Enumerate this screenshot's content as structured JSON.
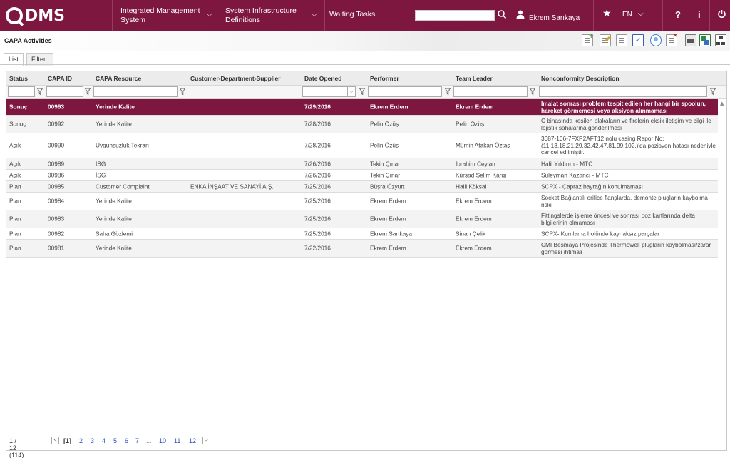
{
  "app": {
    "logo_text": "DMS",
    "menu": [
      {
        "label": "Integrated Management System"
      },
      {
        "label": "System Infrastructure Definitions"
      },
      {
        "label": "Waiting Tasks"
      }
    ],
    "search": {
      "value": "",
      "placeholder": ""
    },
    "user_name": "Ekrem Sarıkaya",
    "language": "EN"
  },
  "page": {
    "title": "CAPA Activities",
    "tabs": [
      {
        "label": "List"
      },
      {
        "label": "Filter"
      }
    ],
    "active_tab": "List"
  },
  "grid": {
    "columns": [
      "Status",
      "CAPA ID",
      "CAPA Resource",
      "Customer-Department-Supplier",
      "Date Opened",
      "Performer",
      "Team Leader",
      "Nonconformity Description"
    ],
    "rows": [
      {
        "status": "Sonuç",
        "id": "00993",
        "resource": "Yerinde Kalite",
        "customer": "",
        "date": "7/29/2016",
        "performer": "Ekrem Erdem",
        "leader": "Ekrem Erdem",
        "desc1": "İmalat sonrası problem tespit edilen her hangi bir spoolun,",
        "desc2": "hareket görmemesi veya aksiyon alınmaması",
        "selected": true
      },
      {
        "status": "Sonuç",
        "id": "00992",
        "resource": "Yerinde Kalite",
        "customer": "",
        "date": "7/28/2016",
        "performer": "Pelin Özüş",
        "leader": "Pelin Özüş",
        "desc1": "C binasında kesilen plakaların ve firelerin eksik iletişim ve bilgi ile",
        "desc2": "lojistik sahalarına gönderilmesi"
      },
      {
        "status": "Açık",
        "id": "00990",
        "resource": "Uygunsuzluk Tekrarı",
        "customer": "",
        "date": "7/28/2016",
        "performer": "Pelin Özüş",
        "leader": "Mümin Atakan Öztaş",
        "desc1": "3087-106-7FXP2AFT12 nolu casing Rapor No:",
        "desc2": "(11,13,18,21,29,32,42,47,81,99,102,)'da pozisyon hatası nedeniyle",
        "desc3": "cancel edilmiştir."
      },
      {
        "status": "Açık",
        "id": "00989",
        "resource": "İSG",
        "customer": "",
        "date": "7/26/2016",
        "performer": "Tekin Çınar",
        "leader": "İbrahim Ceylan",
        "desc1": "Halil Yıldırım - MTC"
      },
      {
        "status": "Açık",
        "id": "00986",
        "resource": "İSG",
        "customer": "",
        "date": "7/26/2016",
        "performer": "Tekin Çınar",
        "leader": "Kürşad Selim Kargı",
        "desc1": "Süleyman Kazancı - MTC"
      },
      {
        "status": "Plan",
        "id": "00985",
        "resource": "Customer Complaint",
        "customer": "ENKA İNŞAAT VE SANAYİ A.Ş.",
        "date": "7/25/2016",
        "performer": "Büşra Özyurt",
        "leader": "Halil Köksal",
        "desc1": "SCPX - Çapraz bayrağın konulmaması"
      },
      {
        "status": "Plan",
        "id": "00984",
        "resource": "Yerinde Kalite",
        "customer": "",
        "date": "7/25/2016",
        "performer": "Ekrem Erdem",
        "leader": "Ekrem Erdem",
        "desc1": "Socket Bağlantılı orifice flanşlarda, demonte plugların kaybolma",
        "desc2": "riski"
      },
      {
        "status": "Plan",
        "id": "00983",
        "resource": "Yerinde Kalite",
        "customer": "",
        "date": "7/25/2016",
        "performer": "Ekrem Erdem",
        "leader": "Ekrem Erdem",
        "desc1": "Fittingslerde işleme öncesi ve sonrası poz kartlarında delta",
        "desc2": "bilgilerinin olmaması"
      },
      {
        "status": "Plan",
        "id": "00982",
        "resource": "Saha Gözlemi",
        "customer": "",
        "date": "7/25/2016",
        "performer": "Ekrem Sarıkaya",
        "leader": "Sinan Çelik",
        "desc1": "SCPX- Kumlama holünde kaynaksız parçalar"
      },
      {
        "status": "Plan",
        "id": "00981",
        "resource": "Yerinde Kalite",
        "customer": "",
        "date": "7/22/2016",
        "performer": "Ekrem Erdem",
        "leader": "Ekrem Erdem",
        "desc1": "CMI Besmaya Projesinde Thermowell plugların kaybolması/zarar",
        "desc2": "görmesi ihtimali"
      }
    ]
  },
  "pager": {
    "summary": "1 / 12 (114)",
    "current": "[1]",
    "pages": [
      "2",
      "3",
      "4",
      "5",
      "6",
      "7",
      "...",
      "10",
      "11",
      "12"
    ]
  }
}
